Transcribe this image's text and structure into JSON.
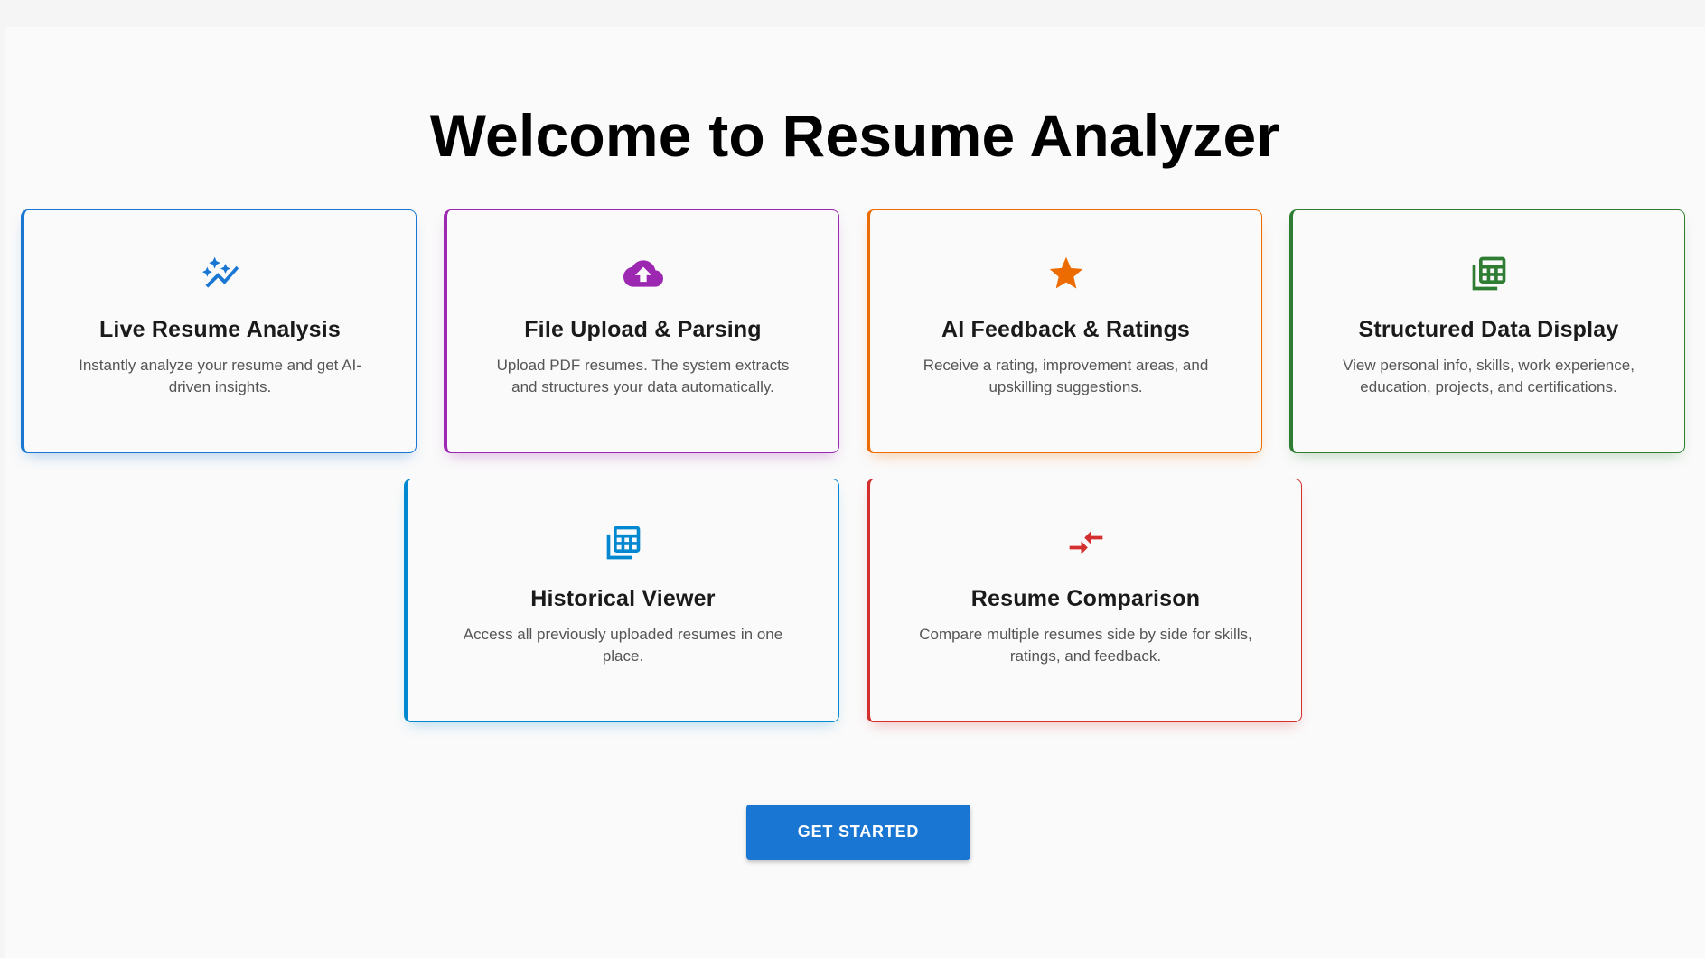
{
  "page": {
    "title": "Welcome to Resume Analyzer"
  },
  "features": [
    {
      "title": "Live Resume Analysis",
      "description": "Instantly analyze your resume and get AI-driven insights.",
      "icon": "auto-graph-icon",
      "color": "#1976d2"
    },
    {
      "title": "File Upload & Parsing",
      "description": "Upload PDF resumes. The system extracts and structures your data automatically.",
      "icon": "cloud-upload-icon",
      "color": "#9c27b0"
    },
    {
      "title": "AI Feedback & Ratings",
      "description": "Receive a rating, improvement areas, and upskilling suggestions.",
      "icon": "star-icon",
      "color": "#ed6c02"
    },
    {
      "title": "Structured Data Display",
      "description": "View personal info, skills, work experience, education, projects, and certifications.",
      "icon": "table-stack-icon",
      "color": "#2e7d32"
    },
    {
      "title": "Historical Viewer",
      "description": "Access all previously uploaded resumes in one place.",
      "icon": "history-table-icon",
      "color": "#0288d1"
    },
    {
      "title": "Resume Comparison",
      "description": "Compare multiple resumes side by side for skills, ratings, and feedback.",
      "icon": "compare-arrows-icon",
      "color": "#d32f2f"
    }
  ],
  "actions": {
    "get_started_label": "GET STARTED"
  }
}
